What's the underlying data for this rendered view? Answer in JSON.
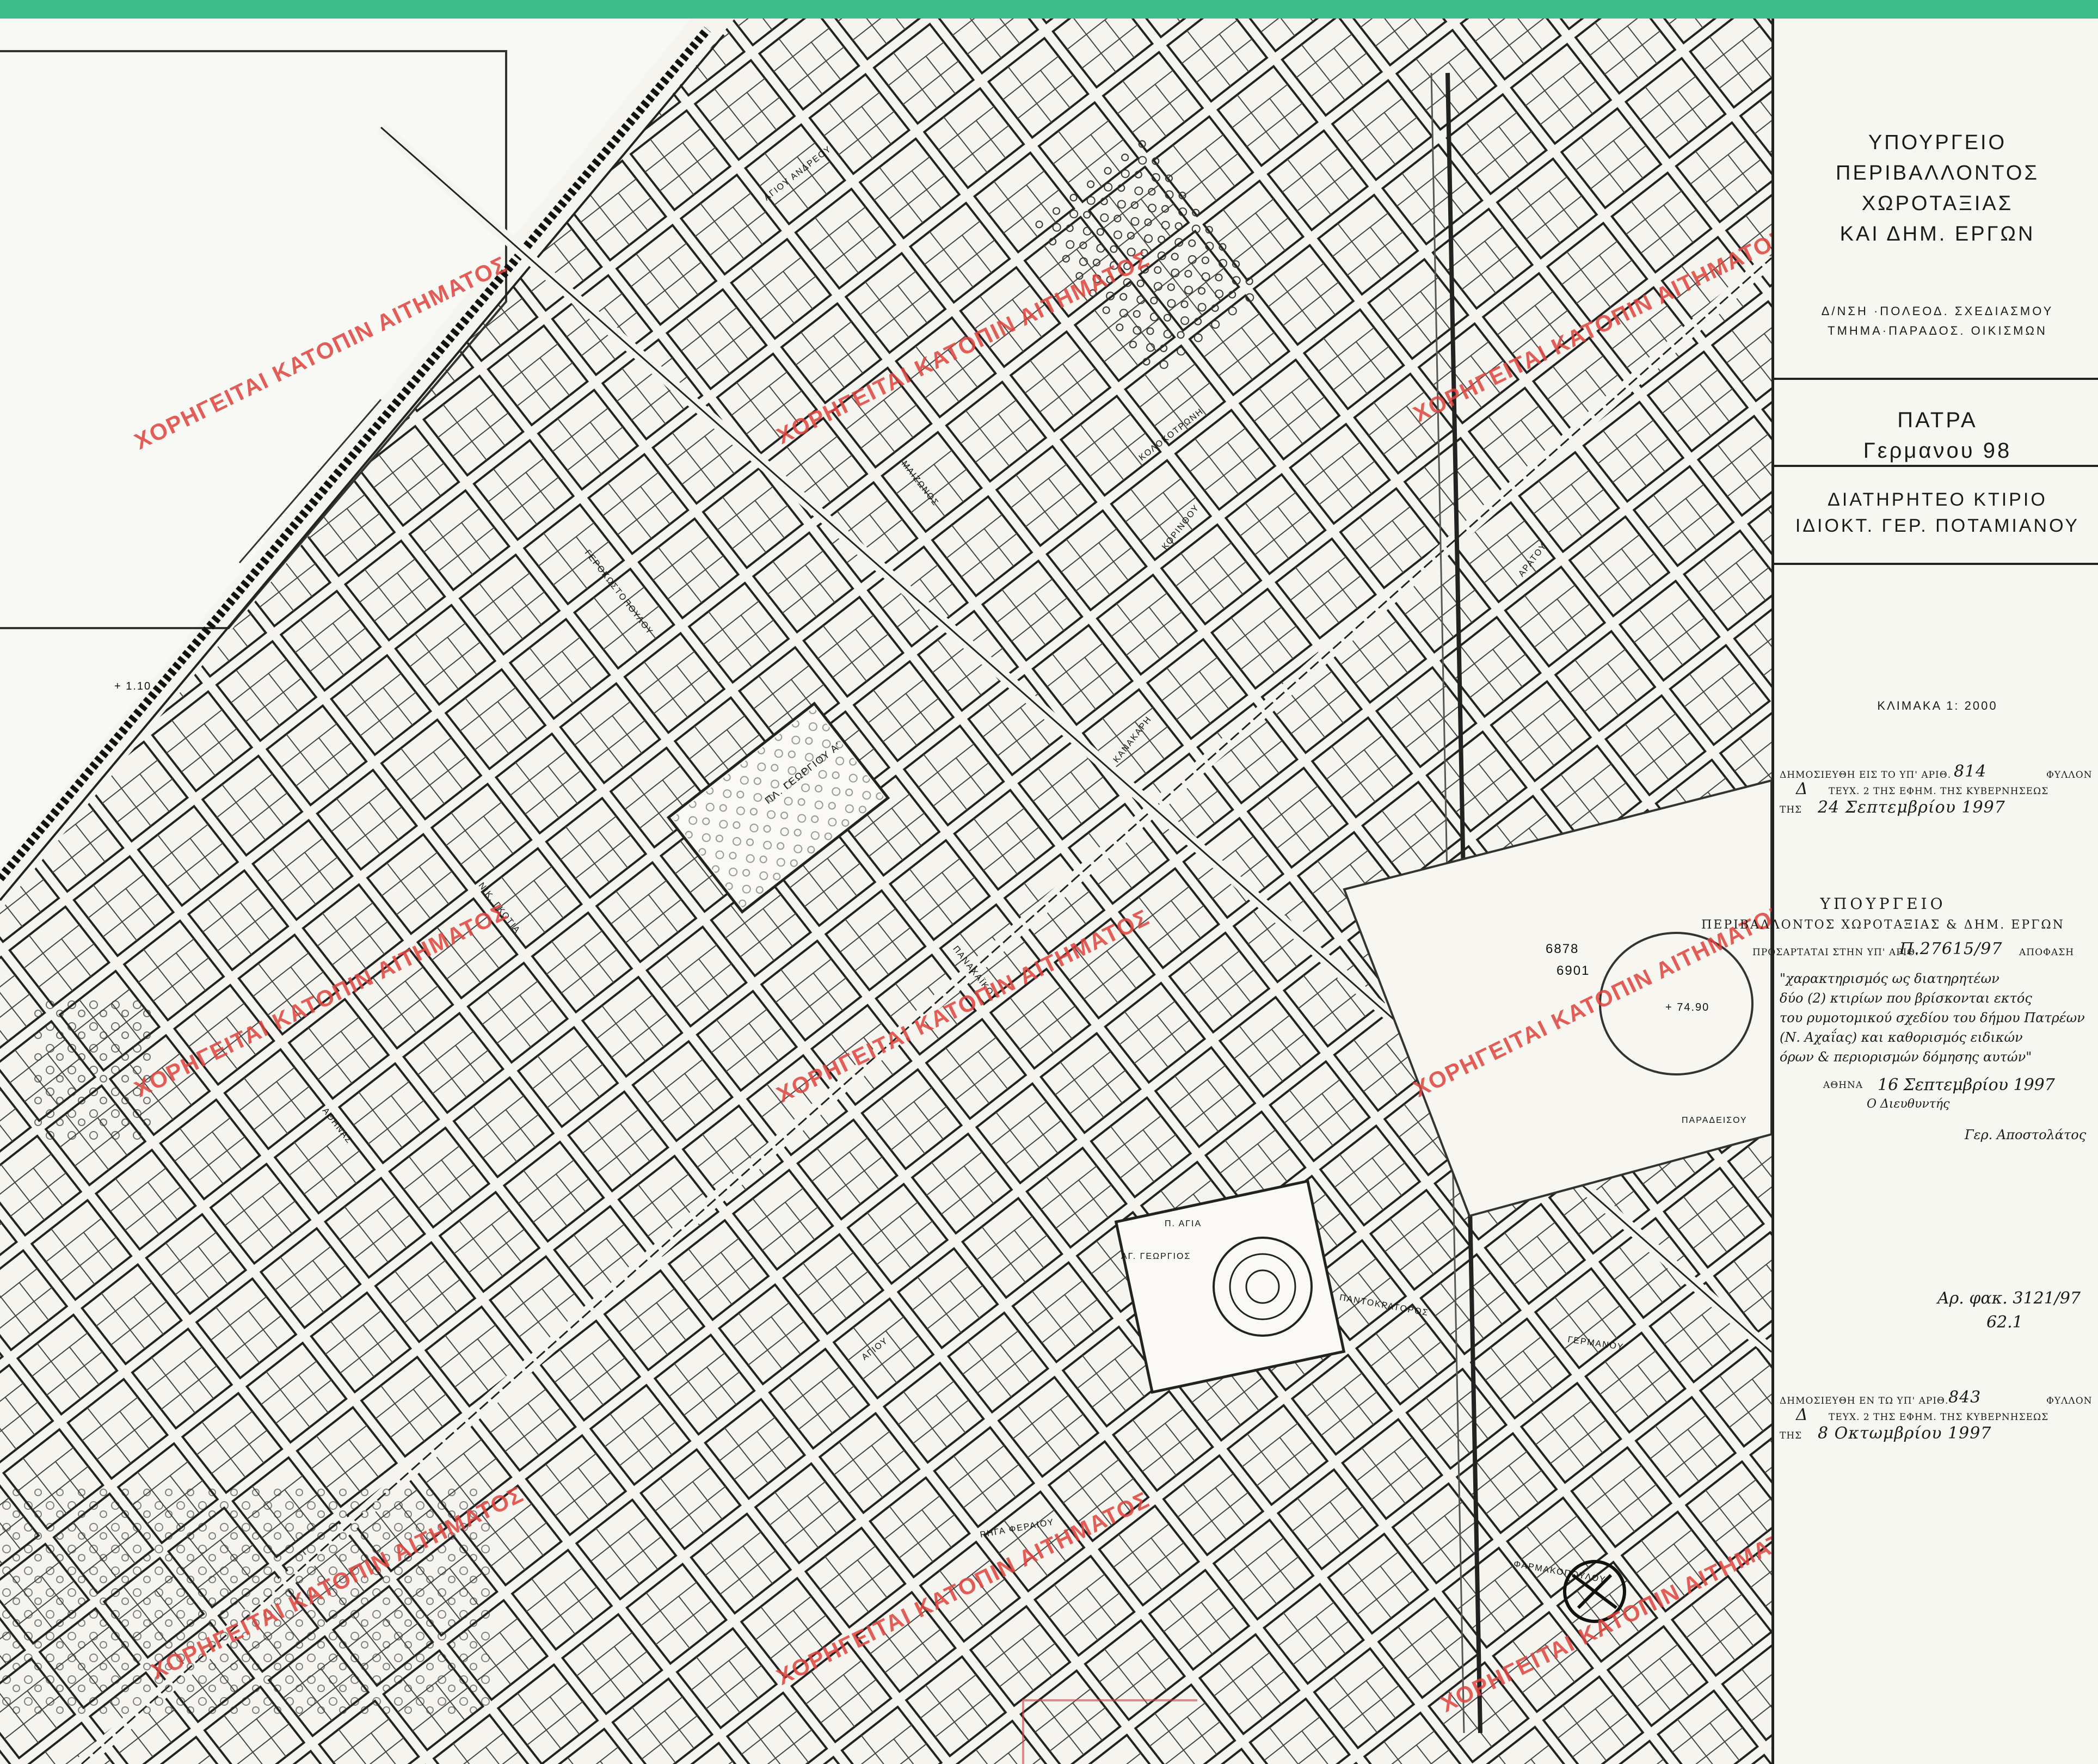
{
  "title_block": {
    "ministry": [
      "ΥΠΟΥΡΓΕΙΟ",
      "ΠΕΡΙΒΑΛΛΟΝΤΟΣ",
      "ΧΩΡΟΤΑΞΙΑΣ",
      "ΚΑΙ ΔΗΜ. ΕΡΓΩΝ"
    ],
    "department": [
      "Δ/ΝΣΗ ·ΠΟΛΕΟΔ. ΣΧΕΔΙΑΣΜΟΥ",
      "ΤΜΗΜΑ·ΠΑΡΑΔΟΣ. ΟΙΚΙΣΜΩΝ"
    ],
    "place": "ΠΑΤΡΑ",
    "address": "Γερμανου 98",
    "designation": "ΔΙΑΤΗΡΗΤΕΟ ΚΤΙΡΙΟ",
    "owner": "ΙΔΙΟΚΤ. ΓΕΡ. ΠΟΤΑΜΙΑΝΟΥ",
    "scale": "ΚΛΙΜΑΚΑ 1: 2000"
  },
  "publication_1": {
    "line1": "ΔΗΜΟΣΙΕΥΘΗ ΕΙΣ ΤΟ ΥΠ' ΑΡΙΘ.",
    "number": "814",
    "line1_end": "ΦΥΛΛΟΝ",
    "issue": "Δ",
    "line2": "ΤΕΥΧ. 2 ΤΗΣ ΕΦΗΜ. ΤΗΣ ΚΥΒΕΡΝΗΣΕΩΣ",
    "date_prefix": "ΤΗΣ",
    "date": "24 Σεπτεμβρίου 1997"
  },
  "decision_stamp": {
    "ministry": "ΥΠΟΥΡΓΕΙΟ",
    "ministry_full": "ΠΕΡΙΒΑΛΛΟΝΤΟΣ ΧΩΡΟΤΑΞΙΑΣ & ΔΗΜ. ΕΡΓΩΝ",
    "ref_label": "ΠΡΟΣΑΡΤΑΤΑΙ ΣΤΗΝ ΥΠ' ΑΡΙΘ.",
    "ref_number": "Π.27615/97",
    "ref_end": "ΑΠΟΦΑΣΗ",
    "handwritten": [
      "\"χαρακτηρισμός ως διατηρητέων",
      "δύο (2) κτιρίων που βρίσκονται εκτός",
      "του ρυμοτομικού σχεδίου του δήμου Πατρέων",
      "(Ν. Αχαΐας) και καθορισμός ειδικών",
      "όρων & περιορισμών δόμησης αυτών\""
    ],
    "city_date_label": "ΑΘΗΝΑ",
    "city_date": "16 Σεπτεμβρίου 1997",
    "director_label": "Ο Διευθυντής",
    "signature": "Γερ. Αποστολάτος"
  },
  "file_note": [
    "Αρ. φακ. 3121/97",
    "62.1"
  ],
  "publication_2": {
    "line1": "ΔΗΜΟΣΙΕΥΘΗ ΕΝ ΤΩ ΥΠ' ΑΡΙΘ.",
    "number": "843",
    "line1_end": "ΦΥΛΛΟΝ",
    "issue": "Δ",
    "line2": "ΤΕΥΧ. 2 ΤΗΣ ΕΦΗΜ. ΤΗΣ ΚΥΒΕΡΝΗΣΕΩΣ",
    "date_prefix": "ΤΗΣ",
    "date": "8 Οκτωμβρίου 1997"
  },
  "watermark": "ΧΟΡΗΓΕΙΤΑΙ ΚΑΤΟΠΙΝ ΑΙΤΗΜΑΤΟΣ",
  "map_labels": {
    "square_1": "ΠΛ. ΓΕΩΡΓΙΟΥ Α'",
    "square_2": "Π. ΑΓΙΑ",
    "square_2b": "ΑΓ. ΓΕΩΡΓΙΟΣ",
    "streets": [
      "ΑΓΙΟΥ ΑΝΔΡΕΟΥ",
      "ΚΟΛΟΚΟΤΡΩΝΗ",
      "ΚΟΡΙΝΘΟΥ",
      "ΜΑΙΖΩΝΟΣ",
      "ΓΕΡΟΚΩΣΤΟΠΟΥΛΟΥ",
      "ΚΑΝΑΚΑΡΗ",
      "ΠΑΡΑΔΕΙΣΟΥ",
      "ΓΕΡΜΑΝΟΥ",
      "ΠΑΝΤΟΚΡΑΤΟΡΟΣ",
      "ΦΑΡΜΑΚΟΠΟΥΛΟΥ",
      "ΑΘΗΝΑΣ",
      "ΠΑΝΑΧΑΪΚΟΥ",
      "ΡΗΓΑ ΦΕΡΑΙΟΥ",
      "ΝΙΚ. ΓΚΟΤΙΑ",
      "ΑΡΑΤΟΥ",
      "ΑΓΙΟΥ"
    ],
    "elevation_1": "+ 1.10",
    "elevation_2": "+ 74.90",
    "ref_a": "6878",
    "ref_b": "6901"
  },
  "colors": {
    "watermark": "#e0433d",
    "topbar": "#3dbb8a",
    "ink": "#1a1a1a"
  }
}
